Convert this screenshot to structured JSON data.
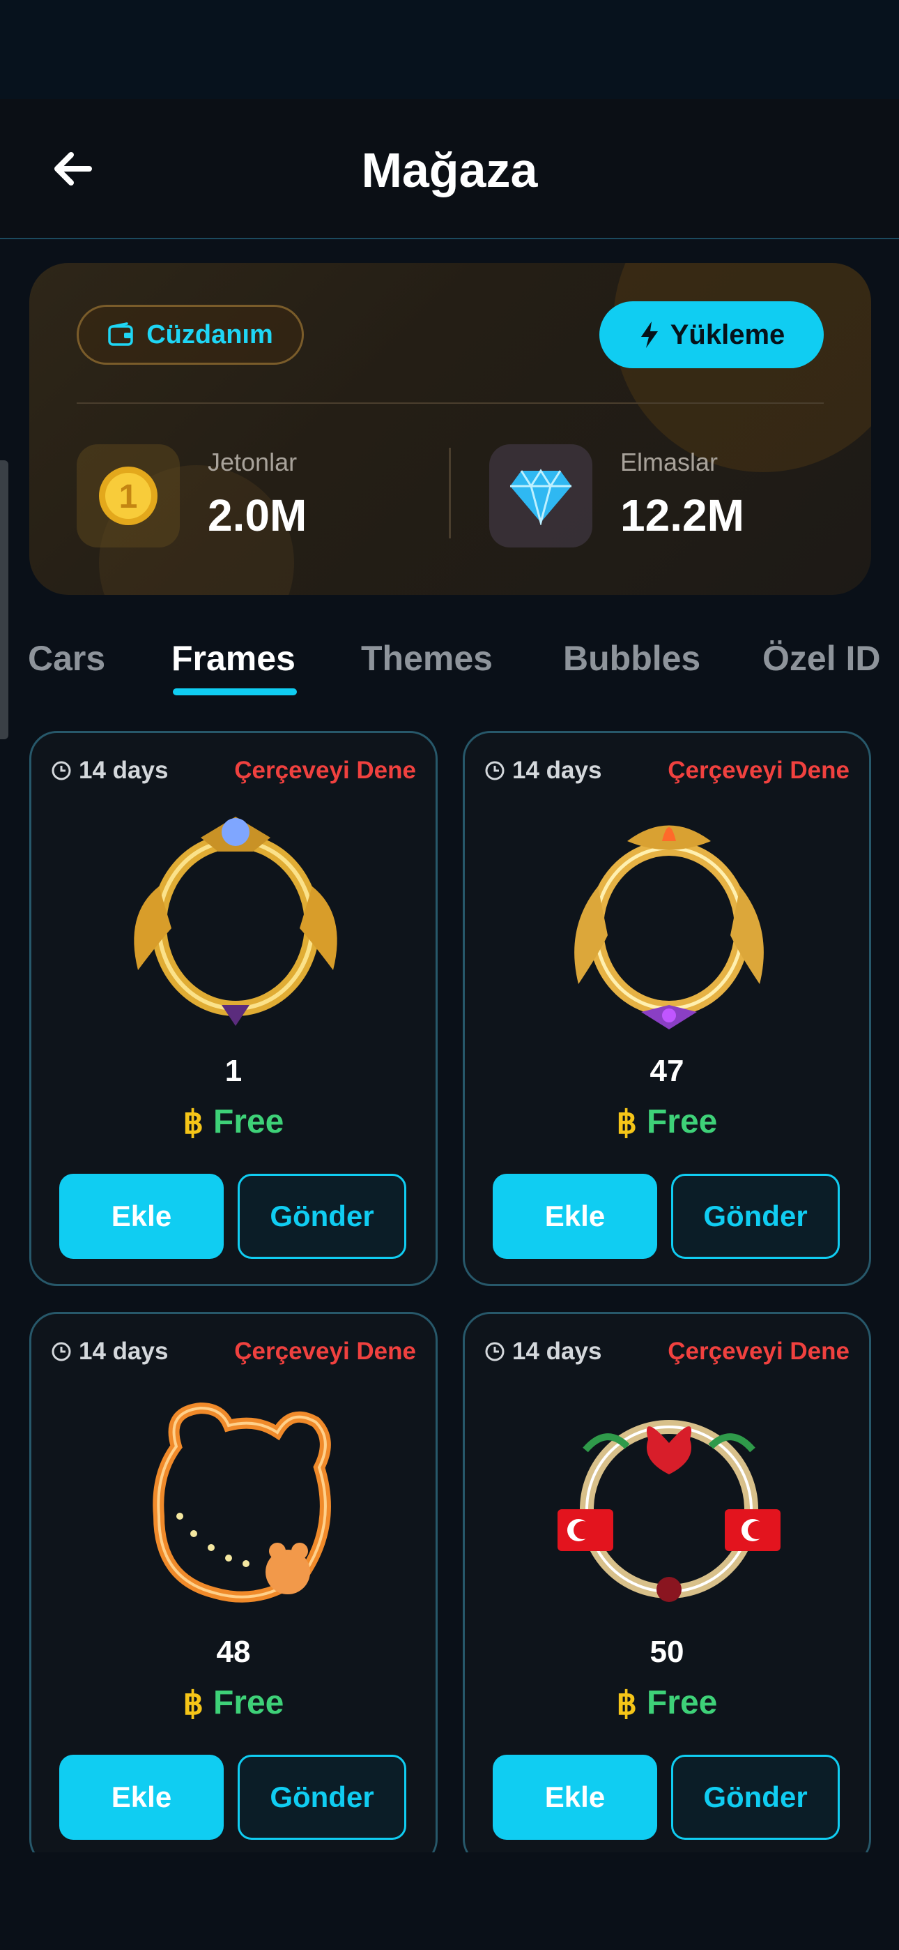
{
  "header": {
    "title": "Mağaza"
  },
  "wallet": {
    "wallet_label": "Cüzdanım",
    "topup_label": "Yükleme",
    "coins": {
      "label": "Jetonlar",
      "value": "2.0M"
    },
    "diamonds": {
      "label": "Elmaslar",
      "value": "12.2M"
    }
  },
  "tabs": [
    {
      "label": "Cars"
    },
    {
      "label": "Frames"
    },
    {
      "label": "Themes"
    },
    {
      "label": "Bubbles"
    },
    {
      "label": "Özel ID"
    }
  ],
  "active_tab": "Frames",
  "items": [
    {
      "duration": "14 days",
      "try_label": "Çerçeveyi Dene",
      "number": "1",
      "price_symbol": "฿",
      "price": "Free",
      "add_label": "Ekle",
      "send_label": "Gönder"
    },
    {
      "duration": "14 days",
      "try_label": "Çerçeveyi Dene",
      "number": "47",
      "price_symbol": "฿",
      "price": "Free",
      "add_label": "Ekle",
      "send_label": "Gönder"
    },
    {
      "duration": "14 days",
      "try_label": "Çerçeveyi Dene",
      "number": "48",
      "price_symbol": "฿",
      "price": "Free",
      "add_label": "Ekle",
      "send_label": "Gönder"
    },
    {
      "duration": "14 days",
      "try_label": "Çerçeveyi Dene",
      "number": "50",
      "price_symbol": "฿",
      "price": "Free",
      "add_label": "Ekle",
      "send_label": "Gönder"
    }
  ],
  "colors": {
    "accent": "#10cdf2",
    "price": "#3ed178",
    "try": "#f0413f",
    "coin": "#f5c518"
  }
}
